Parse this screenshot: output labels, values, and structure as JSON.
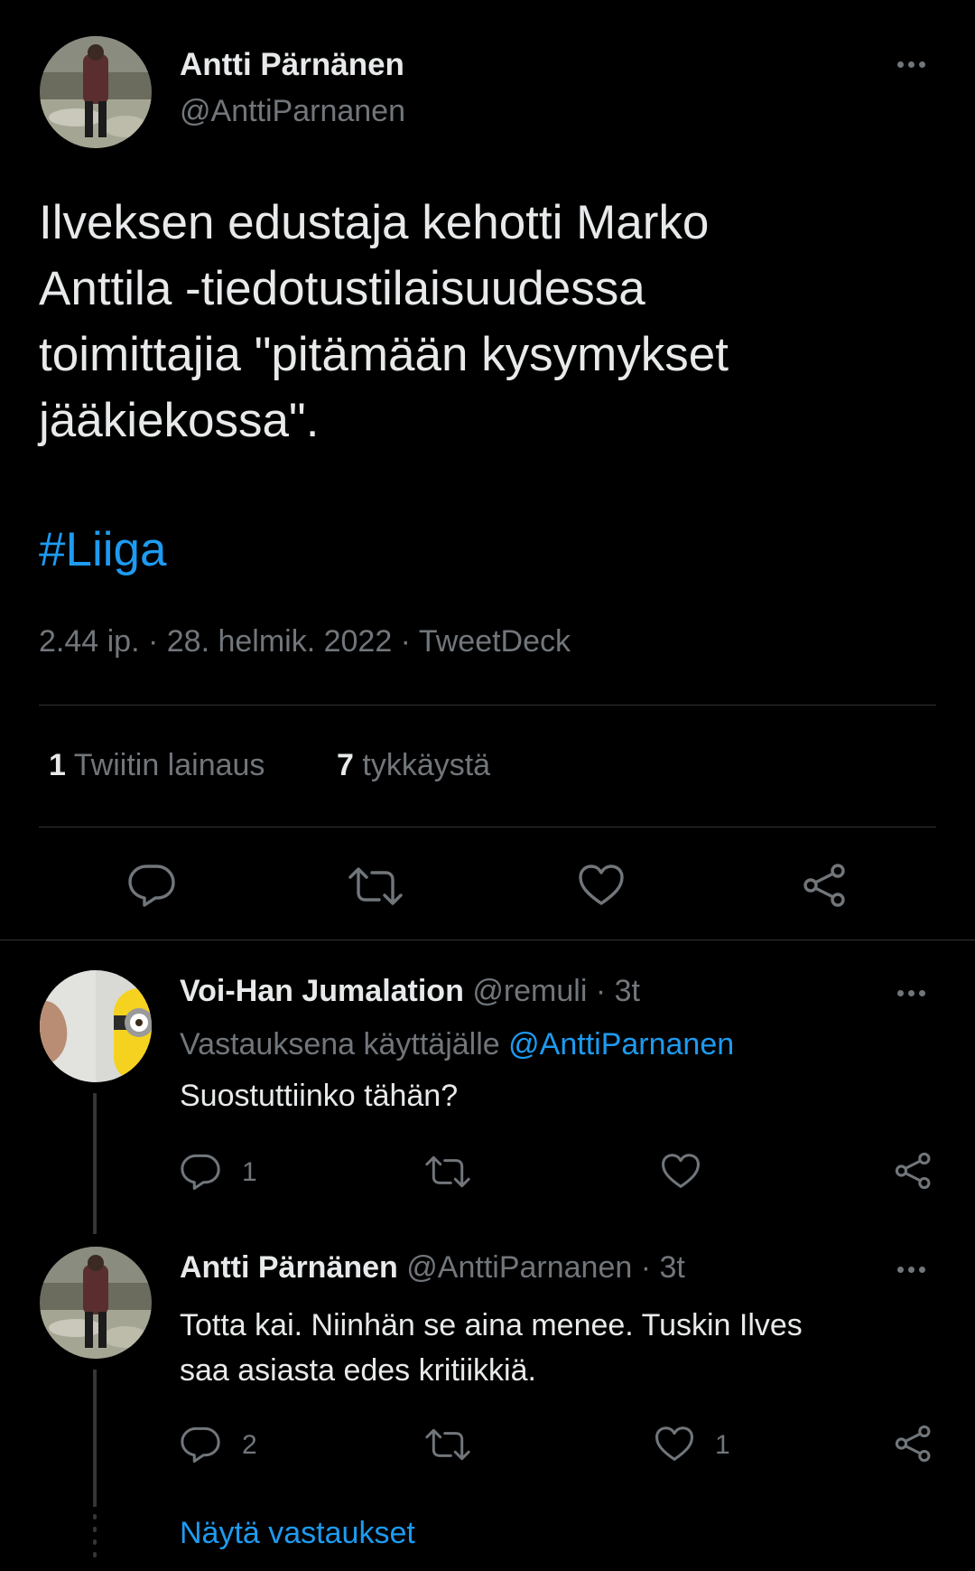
{
  "main_tweet": {
    "author_name": "Antti Pärnänen",
    "author_handle": "@AnttiParnanen",
    "text_lines": [
      "Ilveksen edustaja kehotti Marko",
      "Anttila -tiedotustilaisuudessa",
      "toimittajia \"pitämään kysymykset",
      "jääkiekossa\"."
    ],
    "hashtag": "#Liiga",
    "meta": "2.44 ip. · 28. helmik. 2022 · TweetDeck",
    "stats": {
      "quotes_count": "1",
      "quotes_label": "Twiitin lainaus",
      "likes_count": "7",
      "likes_label": "tykkäystä"
    }
  },
  "replies": [
    {
      "author_name": "Voi-Han Jumalation",
      "author_handle": "@remuli",
      "time": "· 3t",
      "replying_prefix": "Vastauksena käyttäjälle",
      "replying_to": "@AnttiParnanen",
      "text_lines": [
        "Suostuttiinko tähän?"
      ],
      "reply_count": "1",
      "retweet_count": "",
      "like_count": ""
    },
    {
      "author_name": "Antti Pärnänen",
      "author_handle": "@AnttiParnanen",
      "time": "· 3t",
      "text_lines": [
        "Totta kai. Niinhän se aina menee. Tuskin Ilves",
        "saa asiasta edes kritiikkiä."
      ],
      "reply_count": "2",
      "retweet_count": "",
      "like_count": "1"
    }
  ],
  "show_replies": "Näytä vastaukset",
  "icons": [
    "reply-icon",
    "retweet-icon",
    "like-icon",
    "share-icon",
    "more-icon"
  ],
  "colors": {
    "background": "#000000",
    "text": "#e7e9ea",
    "secondary": "#71767b",
    "accent": "#1d9bf0",
    "divider": "#2f3336"
  }
}
